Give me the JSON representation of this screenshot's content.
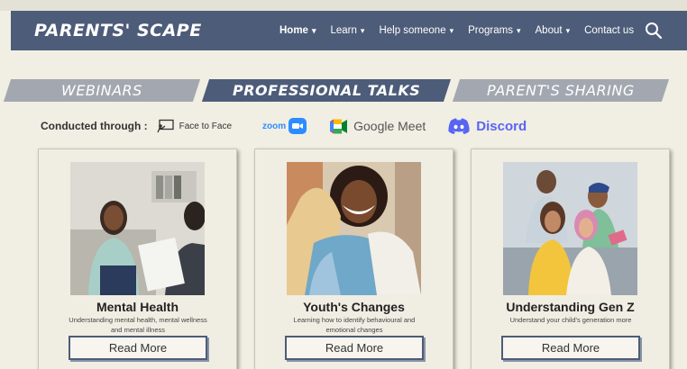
{
  "brand": "PARENTS' SCAPE",
  "nav": [
    {
      "label": "Home",
      "caret": "▾"
    },
    {
      "label": "Learn",
      "caret": "▾"
    },
    {
      "label": "Help someone",
      "caret": "▾"
    },
    {
      "label": "Programs",
      "caret": "▾"
    },
    {
      "label": "About",
      "caret": "▾"
    },
    {
      "label": "Contact us",
      "caret": ""
    }
  ],
  "tabs": [
    "WEBINARS",
    "PROFESSIONAL TALKS",
    "PARENT'S SHARING"
  ],
  "active_tab": "PROFESSIONAL TALKS",
  "conducted": {
    "label": "Conducted through :",
    "platforms": {
      "face": "Face to Face",
      "zoom": "zoom",
      "meet": "Google Meet",
      "discord": "Discord"
    }
  },
  "cards": [
    {
      "title": "Mental Health",
      "desc_line1": "Understanding mental health, mental wellness",
      "desc_line2": "and mental illness",
      "button": "Read More"
    },
    {
      "title": "Youth's Changes",
      "desc_line1": "Learning how to identify behavioural and",
      "desc_line2": "emotional changes",
      "button": "Read More"
    },
    {
      "title": "Understanding Gen Z",
      "desc_line1": "Understand your child's generation more",
      "desc_line2": "",
      "button": "Read More"
    }
  ],
  "colors": {
    "navy": "#4d5c78",
    "tab_inactive": "#a3a8b0",
    "background": "#f1eee4",
    "zoom_blue": "#2d8cff",
    "discord_purple": "#5865f2"
  }
}
